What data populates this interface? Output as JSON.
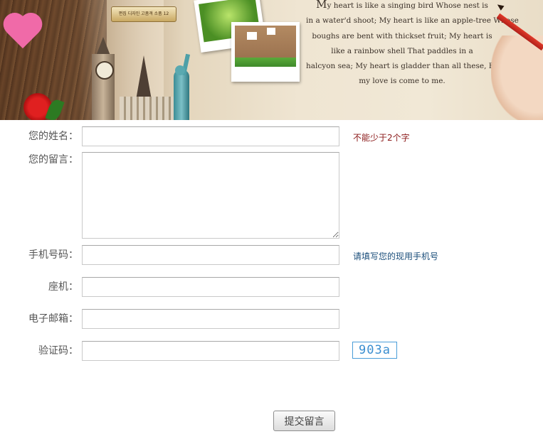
{
  "banner": {
    "badge_text": "편집 디자인 고품격 소품 12",
    "poem_lines": [
      "My heart is like a singing bird Whose nest is",
      "in a water'd shoot; My heart is like an apple-tree Whose",
      "boughs are bent with thickset fruit; My heart is",
      "like a rainbow shell That paddles in a",
      "halcyon sea; My heart is gladder than all these, Because",
      "my love is come to me."
    ]
  },
  "form": {
    "name": {
      "label": "您的姓名：",
      "value": "",
      "hint": "不能少于2个字"
    },
    "message": {
      "label": "您的留言：",
      "value": ""
    },
    "mobile": {
      "label": "手机号码：",
      "value": "",
      "hint": "请填写您的现用手机号"
    },
    "phone": {
      "label": "座机：",
      "value": ""
    },
    "email": {
      "label": "电子邮箱：",
      "value": ""
    },
    "captcha": {
      "label": "验证码：",
      "value": "",
      "code": "903a"
    },
    "submit_label": "提交留言"
  },
  "colors": {
    "hint_red": "#8b1a1a",
    "hint_blue": "#1a4d7a",
    "captcha_blue": "#3a8ed0"
  }
}
